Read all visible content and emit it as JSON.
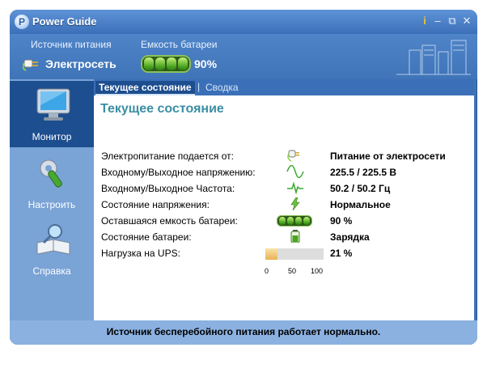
{
  "app": {
    "title": "Power Guide",
    "logo_glyph": "P"
  },
  "window_controls": {
    "info_glyph": "i",
    "minimize_glyph": "–",
    "restore_glyph": "⧉",
    "close_glyph": "✕"
  },
  "header": {
    "power_source_label": "Источник питания",
    "battery_capacity_label": "Емкость батареи",
    "power_source_value": "Электросеть",
    "battery_value": "90%"
  },
  "sidebar": {
    "items": [
      {
        "label": "Монитор",
        "icon": "monitor-icon",
        "active": true
      },
      {
        "label": "Настроить",
        "icon": "settings-icon",
        "active": false
      },
      {
        "label": "Справка",
        "icon": "help-icon",
        "active": false
      }
    ]
  },
  "tabs": [
    {
      "label": "Текущее состояние",
      "active": true
    },
    {
      "label": "Сводка",
      "active": false
    }
  ],
  "tab_separator": "|",
  "main": {
    "heading": "Текущее состояние",
    "rows": [
      {
        "label": "Электропитание подается от:",
        "value": "Питание от электросети",
        "icon": "plug-icon"
      },
      {
        "label": "Входному/Выходное напряжению:",
        "value": "225.5 / 225.5 В",
        "icon": "sine-wave-icon"
      },
      {
        "label": "Входному/Выходное Частота:",
        "value": "50.2 / 50.2 Гц",
        "icon": "pulse-icon"
      },
      {
        "label": "Состояние напряжения:",
        "value": "Нормальное",
        "icon": "lightning-icon"
      },
      {
        "label": "Оставшаяся емкость батареи:",
        "value": "90 %",
        "icon": "battery-icon"
      },
      {
        "label": "Состояние батареи:",
        "value": "Зарядка",
        "icon": "battery-charging-icon"
      },
      {
        "label": "Нагрузка на UPS:",
        "value": "21 %",
        "icon": "load-bar"
      }
    ],
    "load_percent": 21,
    "load_scale": [
      "0",
      "50",
      "100"
    ]
  },
  "status_bar": {
    "text": "Источник бесперебойного питания работает нормально."
  },
  "colors": {
    "accent": "#3f74b8",
    "sidebar_active": "#1d4e8f",
    "heading": "#3a8ea3",
    "battery_green": "#4aa51f",
    "load_fill": "#e7b355"
  }
}
